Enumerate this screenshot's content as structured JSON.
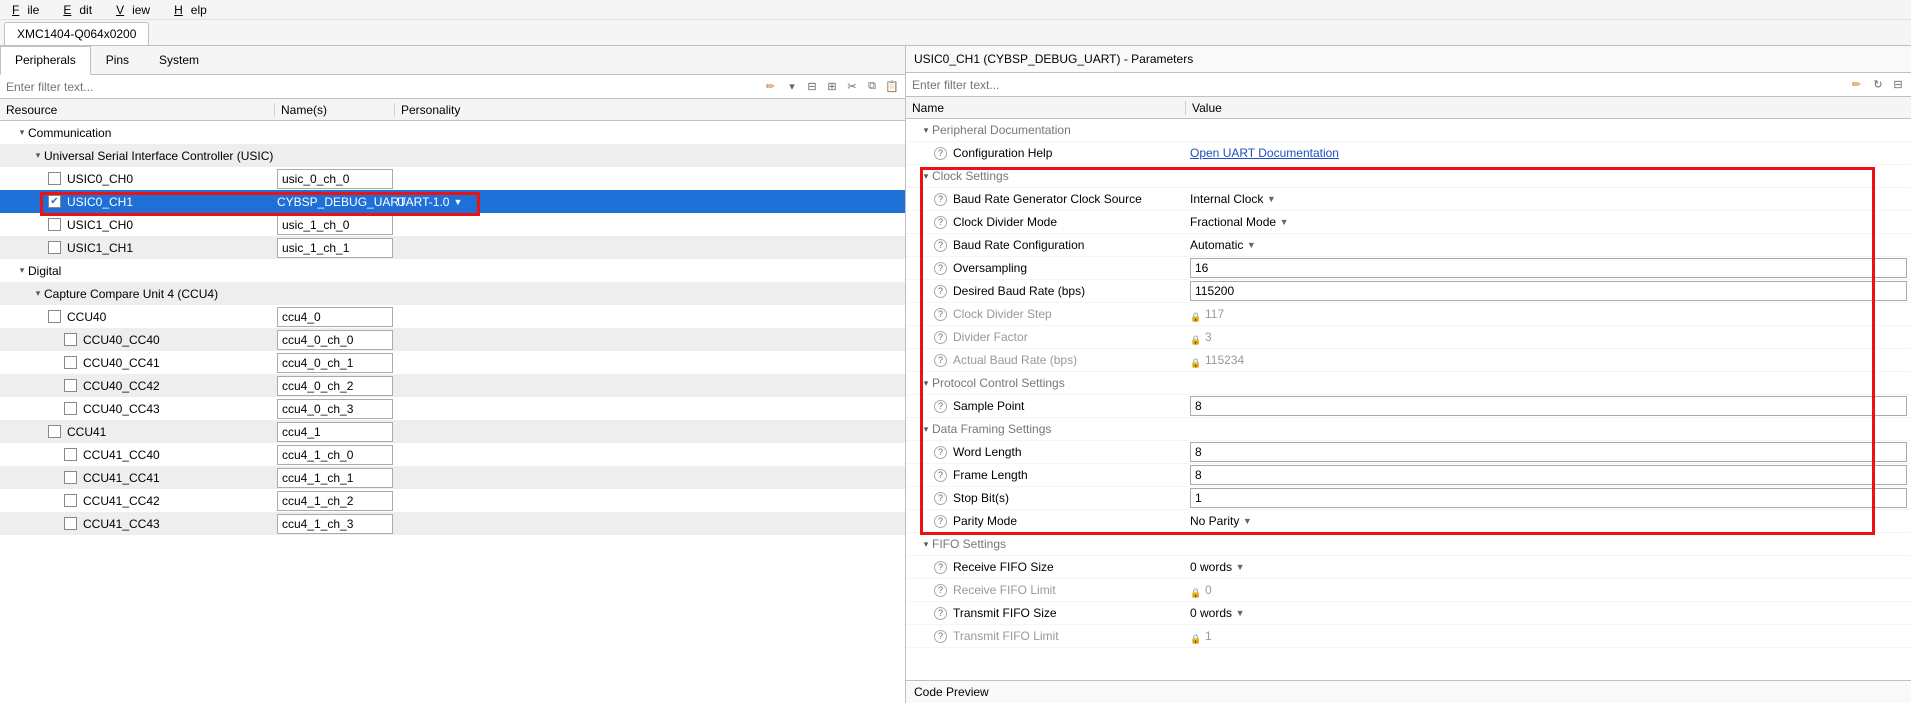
{
  "menu": {
    "file": "File",
    "edit": "Edit",
    "view": "View",
    "help": "Help"
  },
  "device_tab": "XMC1404-Q064x0200",
  "sub_tabs": {
    "peripherals": "Peripherals",
    "pins": "Pins",
    "system": "System"
  },
  "left": {
    "filter_placeholder": "Enter filter text...",
    "headers": {
      "resource": "Resource",
      "names": "Name(s)",
      "personality": "Personality"
    },
    "rows": [
      {
        "type": "group",
        "indent": 1,
        "expanded": true,
        "label": "Communication"
      },
      {
        "type": "group",
        "indent": 2,
        "expanded": true,
        "label": "Universal Serial Interface Controller (USIC)"
      },
      {
        "type": "item",
        "indent": 3,
        "checked": false,
        "label": "USIC0_CH0",
        "name": "usic_0_ch_0",
        "per": ""
      },
      {
        "type": "item",
        "indent": 3,
        "checked": true,
        "label": "USIC0_CH1",
        "name": "CYBSP_DEBUG_UART",
        "per": "UART-1.0",
        "selected": true,
        "highlight": true
      },
      {
        "type": "item",
        "indent": 3,
        "checked": false,
        "label": "USIC1_CH0",
        "name": "usic_1_ch_0",
        "per": ""
      },
      {
        "type": "item",
        "indent": 3,
        "checked": false,
        "label": "USIC1_CH1",
        "name": "usic_1_ch_1",
        "per": ""
      },
      {
        "type": "group",
        "indent": 1,
        "expanded": true,
        "label": "Digital"
      },
      {
        "type": "group",
        "indent": 2,
        "expanded": true,
        "label": "Capture Compare Unit 4 (CCU4)"
      },
      {
        "type": "item",
        "indent": 3,
        "checked": false,
        "label": "CCU40",
        "name": "ccu4_0",
        "per": ""
      },
      {
        "type": "item",
        "indent": 4,
        "checked": false,
        "label": "CCU40_CC40",
        "name": "ccu4_0_ch_0",
        "per": ""
      },
      {
        "type": "item",
        "indent": 4,
        "checked": false,
        "label": "CCU40_CC41",
        "name": "ccu4_0_ch_1",
        "per": ""
      },
      {
        "type": "item",
        "indent": 4,
        "checked": false,
        "label": "CCU40_CC42",
        "name": "ccu4_0_ch_2",
        "per": ""
      },
      {
        "type": "item",
        "indent": 4,
        "checked": false,
        "label": "CCU40_CC43",
        "name": "ccu4_0_ch_3",
        "per": ""
      },
      {
        "type": "item",
        "indent": 3,
        "checked": false,
        "label": "CCU41",
        "name": "ccu4_1",
        "per": ""
      },
      {
        "type": "item",
        "indent": 4,
        "checked": false,
        "label": "CCU41_CC40",
        "name": "ccu4_1_ch_0",
        "per": ""
      },
      {
        "type": "item",
        "indent": 4,
        "checked": false,
        "label": "CCU41_CC41",
        "name": "ccu4_1_ch_1",
        "per": ""
      },
      {
        "type": "item",
        "indent": 4,
        "checked": false,
        "label": "CCU41_CC42",
        "name": "ccu4_1_ch_2",
        "per": ""
      },
      {
        "type": "item",
        "indent": 4,
        "checked": false,
        "label": "CCU41_CC43",
        "name": "ccu4_1_ch_3",
        "per": ""
      }
    ]
  },
  "right": {
    "title": "USIC0_CH1 (CYBSP_DEBUG_UART) - Parameters",
    "filter_placeholder": "Enter filter text...",
    "headers": {
      "name": "Name",
      "value": "Value"
    },
    "params": [
      {
        "k": "group",
        "indent": 1,
        "label": "Peripheral Documentation"
      },
      {
        "k": "row",
        "indent": 2,
        "label": "Configuration Help",
        "value": "Open UART Documentation",
        "link": true
      },
      {
        "k": "group",
        "indent": 1,
        "label": "Clock Settings"
      },
      {
        "k": "row",
        "indent": 2,
        "label": "Baud Rate Generator Clock Source",
        "value": "Internal Clock",
        "dd": true
      },
      {
        "k": "row",
        "indent": 2,
        "label": "Clock Divider Mode",
        "value": "Fractional Mode",
        "dd": true
      },
      {
        "k": "row",
        "indent": 2,
        "label": "Baud Rate Configuration",
        "value": "Automatic",
        "dd": true
      },
      {
        "k": "row",
        "indent": 2,
        "label": "Oversampling",
        "value": "16",
        "input": true
      },
      {
        "k": "row",
        "indent": 2,
        "label": "Desired Baud Rate (bps)",
        "value": "115200",
        "input": true
      },
      {
        "k": "row",
        "indent": 2,
        "label": "Clock Divider Step",
        "value": "117",
        "locked": true,
        "disabled": true
      },
      {
        "k": "row",
        "indent": 2,
        "label": "Divider Factor",
        "value": "3",
        "locked": true,
        "disabled": true
      },
      {
        "k": "row",
        "indent": 2,
        "label": "Actual Baud Rate (bps)",
        "value": "115234",
        "locked": true,
        "disabled": true
      },
      {
        "k": "group",
        "indent": 1,
        "label": "Protocol Control Settings"
      },
      {
        "k": "row",
        "indent": 2,
        "label": "Sample Point",
        "value": "8",
        "input": true
      },
      {
        "k": "group",
        "indent": 1,
        "label": "Data Framing Settings"
      },
      {
        "k": "row",
        "indent": 2,
        "label": "Word Length",
        "value": "8",
        "input": true
      },
      {
        "k": "row",
        "indent": 2,
        "label": "Frame Length",
        "value": "8",
        "input": true
      },
      {
        "k": "row",
        "indent": 2,
        "label": "Stop Bit(s)",
        "value": "1",
        "input": true
      },
      {
        "k": "row",
        "indent": 2,
        "label": "Parity Mode",
        "value": "No Parity",
        "dd": true
      },
      {
        "k": "group",
        "indent": 1,
        "label": "FIFO Settings"
      },
      {
        "k": "row",
        "indent": 2,
        "label": "Receive FIFO Size",
        "value": "0 words",
        "dd": true
      },
      {
        "k": "row",
        "indent": 2,
        "label": "Receive FIFO Limit",
        "value": "0",
        "locked": true,
        "disabled": true
      },
      {
        "k": "row",
        "indent": 2,
        "label": "Transmit FIFO Size",
        "value": "0 words",
        "dd": true
      },
      {
        "k": "row",
        "indent": 2,
        "label": "Transmit FIFO Limit",
        "value": "1",
        "locked": true,
        "disabled": true
      }
    ],
    "code_preview": "Code Preview"
  }
}
